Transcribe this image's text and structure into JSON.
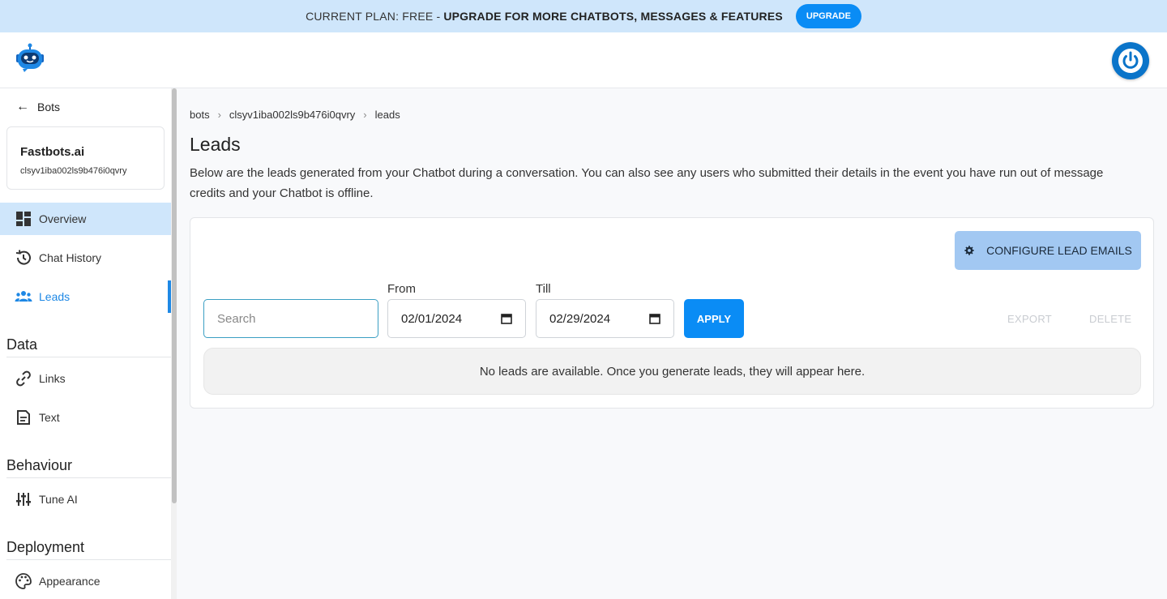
{
  "banner": {
    "plan_text": "CURRENT PLAN: FREE",
    "separator": "-",
    "upsell_text": "UPGRADE FOR MORE CHATBOTS, MESSAGES & FEATURES",
    "upgrade_label": "UPGRADE",
    "background_color": "#cfe6fb",
    "accent_color": "#0a8cf5"
  },
  "topbar": {
    "logo_icon": "robot-logo-icon",
    "power_icon": "power-icon"
  },
  "sidebar": {
    "back_label": "Bots",
    "bot": {
      "name": "Fastbots.ai",
      "id": "clsyv1iba002ls9b476i0qvry"
    },
    "nav": [
      {
        "label": "Overview",
        "icon": "dashboard-icon",
        "state": "highlighted"
      },
      {
        "label": "Chat History",
        "icon": "history-icon"
      },
      {
        "label": "Leads",
        "icon": "people-icon",
        "state": "current"
      }
    ],
    "sections": [
      {
        "title": "Data",
        "items": [
          {
            "label": "Links",
            "icon": "link-icon"
          },
          {
            "label": "Text",
            "icon": "document-icon"
          }
        ]
      },
      {
        "title": "Behaviour",
        "items": [
          {
            "label": "Tune AI",
            "icon": "sliders-icon"
          }
        ]
      },
      {
        "title": "Deployment",
        "items": [
          {
            "label": "Appearance",
            "icon": "palette-icon"
          }
        ]
      }
    ]
  },
  "breadcrumbs": [
    "bots",
    "clsyv1iba002ls9b476i0qvry",
    "leads"
  ],
  "page": {
    "title": "Leads",
    "description": "Below are the leads generated from your Chatbot during a conversation. You can also see any users who submitted their details in the event you have run out of message credits and your Chatbot is offline."
  },
  "leads_panel": {
    "configure_label": "CONFIGURE LEAD EMAILS",
    "search_placeholder": "Search",
    "search_value": "",
    "from_label": "From",
    "from_value": "02/01/2024",
    "till_label": "Till",
    "till_value": "02/29/2024",
    "apply_label": "APPLY",
    "export_label": "EXPORT",
    "delete_label": "DELETE",
    "empty_message": "No leads are available. Once you generate leads, they will appear here."
  }
}
